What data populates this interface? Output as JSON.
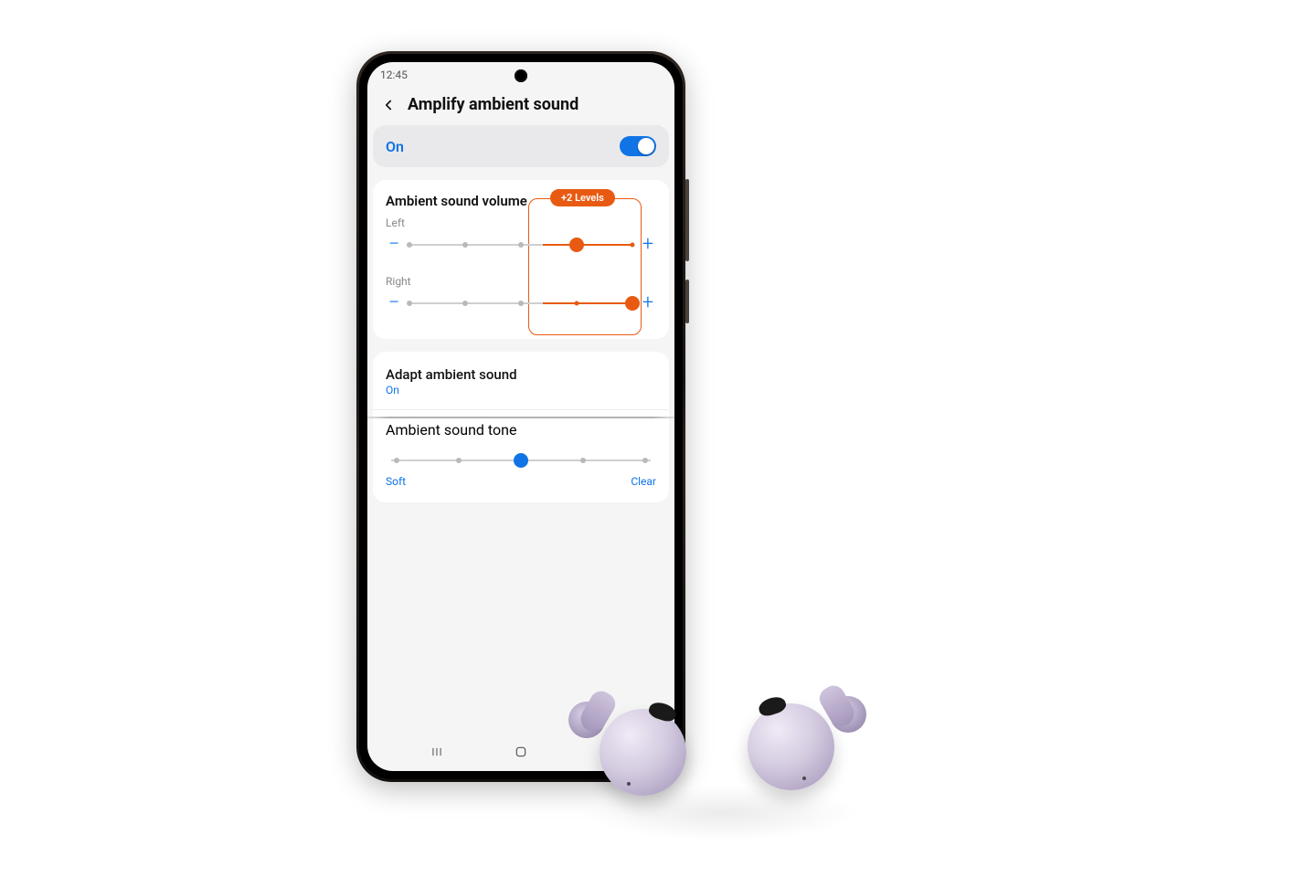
{
  "status": {
    "time": "12:45"
  },
  "header": {
    "title": "Amplify ambient sound"
  },
  "toggle": {
    "label": "On",
    "state": true
  },
  "volume": {
    "title": "Ambient sound volume",
    "left_label": "Left",
    "right_label": "Right",
    "left_value": 3,
    "right_value": 4,
    "steps": 5,
    "badge": "+2 Levels"
  },
  "adapt": {
    "title": "Adapt ambient sound",
    "status": "On"
  },
  "tone": {
    "title": "Ambient sound tone",
    "left_label": "Soft",
    "right_label": "Clear",
    "value": 2,
    "steps": 5
  }
}
